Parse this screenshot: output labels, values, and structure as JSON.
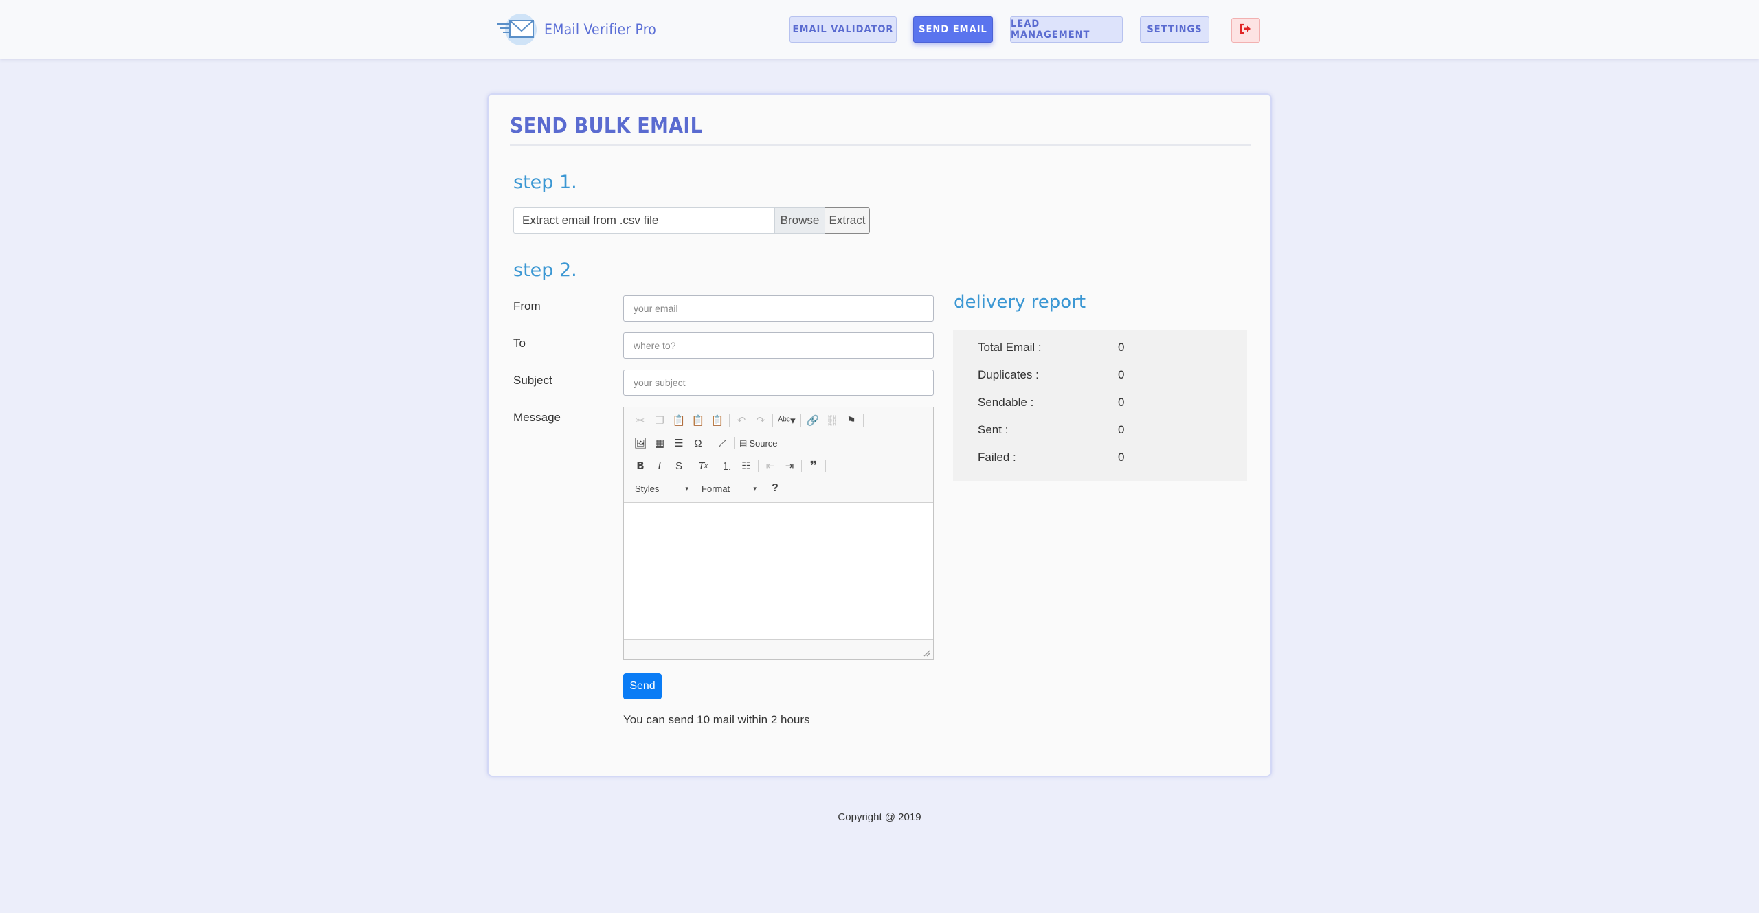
{
  "brand": {
    "name": "EMail Verifier Pro"
  },
  "nav": {
    "items": [
      {
        "label": "EMAIL VALIDATOR"
      },
      {
        "label": "SEND EMAIL",
        "active": true
      },
      {
        "label": "LEAD MANAGEMENT"
      },
      {
        "label": "SETTINGS"
      }
    ],
    "logout_icon": "sign-out-icon"
  },
  "card": {
    "title": "SEND BULK EMAIL",
    "step1": {
      "label": "step 1.",
      "file_placeholder": "Extract email from .csv file",
      "browse_label": "Browse",
      "extract_label": "Extract"
    },
    "step2": {
      "label": "step 2.",
      "from": {
        "label": "From",
        "placeholder": "your email"
      },
      "to": {
        "label": "To",
        "placeholder": "where to?"
      },
      "subject": {
        "label": "Subject",
        "placeholder": "your subject"
      },
      "message": {
        "label": "Message"
      },
      "editor": {
        "source_label": "Source",
        "styles_label": "Styles",
        "format_label": "Format",
        "help_label": "?"
      },
      "send_label": "Send",
      "limit_text": "You can send 10 mail within 2 hours"
    },
    "report": {
      "title": "delivery report",
      "rows": [
        {
          "label": "Total Email :",
          "value": "0"
        },
        {
          "label": "Duplicates :",
          "value": "0"
        },
        {
          "label": "Sendable :",
          "value": "0"
        },
        {
          "label": "Sent :",
          "value": "0"
        },
        {
          "label": "Failed :",
          "value": "0"
        }
      ]
    }
  },
  "footer": {
    "text": "Copyright @ 2019"
  },
  "colors": {
    "accent": "#5a74ee",
    "step": "#3b97d3",
    "send": "#0a7cf5",
    "logout": "#e02424"
  }
}
